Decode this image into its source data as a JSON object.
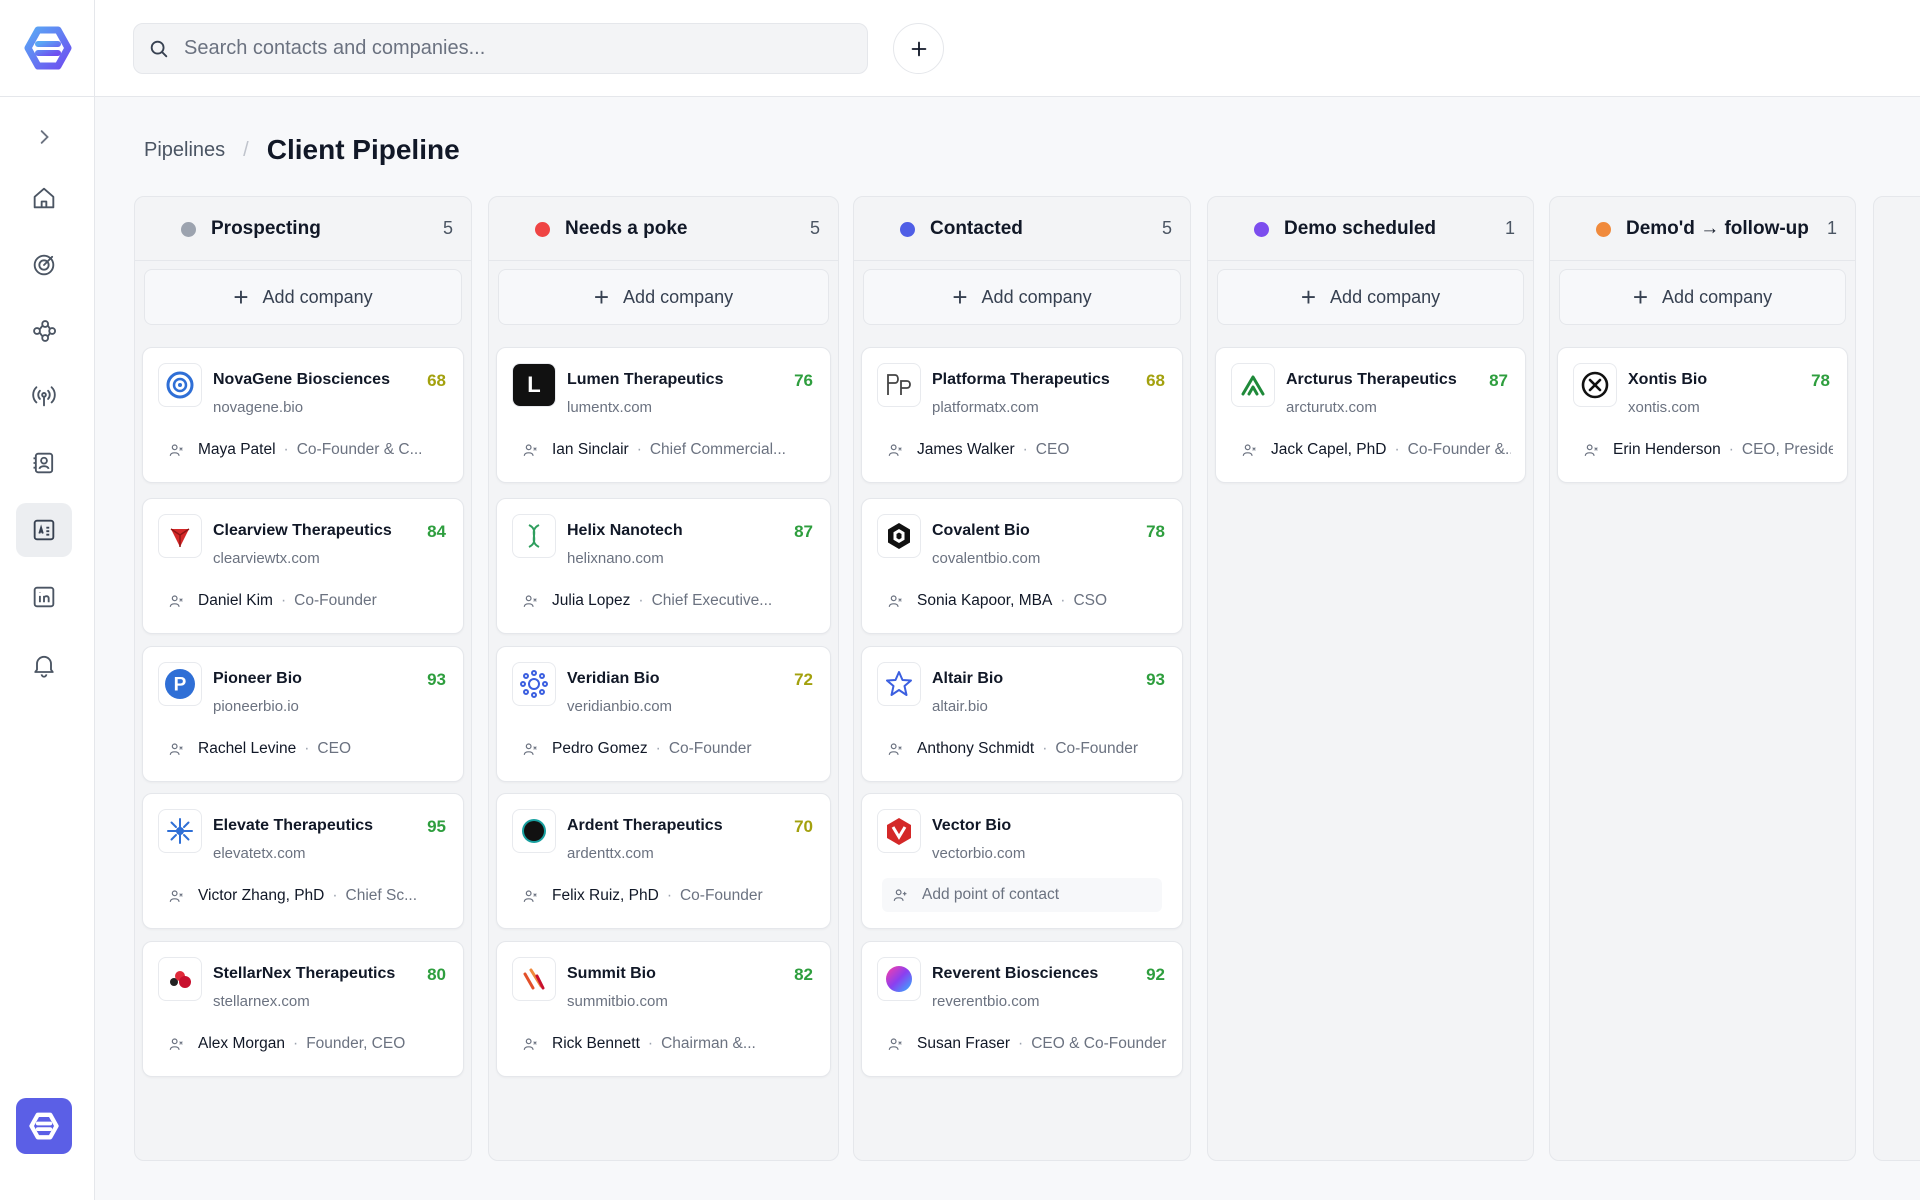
{
  "app": {
    "brand_color": "#5b5fe6"
  },
  "search": {
    "placeholder": "Search contacts and companies..."
  },
  "breadcrumb": {
    "parent": "Pipelines",
    "separator": "/",
    "current": "Client Pipeline"
  },
  "sidebar": {
    "items": [
      {
        "icon": "chevron-right-icon"
      },
      {
        "icon": "home-icon"
      },
      {
        "icon": "target-icon"
      },
      {
        "icon": "network-icon"
      },
      {
        "icon": "broadcast-icon"
      },
      {
        "icon": "contacts-icon"
      },
      {
        "icon": "companies-icon",
        "active": true
      },
      {
        "icon": "linkedin-icon"
      },
      {
        "icon": "bell-icon"
      }
    ]
  },
  "add_company_label": "Add company",
  "columns": [
    {
      "title": "Prospecting",
      "count": "5",
      "color": "#9ca3af",
      "cards": [
        {
          "name": "NovaGene Biosciences",
          "domain": "novagene.bio",
          "score": "68",
          "score_color": "#a3a10e",
          "contact": "Maya Patel",
          "role": "Co-Founder & C...",
          "logo": "novagene"
        },
        {
          "name": "Clearview Therapeutics",
          "domain": "clearviewtx.com",
          "score": "84",
          "score_color": "#2e9e3e",
          "contact": "Daniel Kim",
          "role": "Co-Founder",
          "logo": "clearview"
        },
        {
          "name": "Pioneer Bio",
          "domain": "pioneerbio.io",
          "score": "93",
          "score_color": "#2e9e3e",
          "contact": "Rachel Levine",
          "role": "CEO",
          "logo": "pioneer"
        },
        {
          "name": "Elevate Therapeutics",
          "domain": "elevatetx.com",
          "score": "95",
          "score_color": "#2e9e3e",
          "contact": "Victor Zhang, PhD",
          "role": "Chief Sc...",
          "logo": "elevate"
        },
        {
          "name": "StellarNex Therapeutics",
          "domain": "stellarnex.com",
          "score": "80",
          "score_color": "#2e9e3e",
          "contact": "Alex Morgan",
          "role": "Founder, CEO",
          "logo": "stellarnex"
        }
      ]
    },
    {
      "title": "Needs a poke",
      "count": "5",
      "color": "#ef4444",
      "cards": [
        {
          "name": "Lumen Therapeutics",
          "domain": "lumentx.com",
          "score": "76",
          "score_color": "#2e9e3e",
          "contact": "Ian Sinclair",
          "role": "Chief Commercial...",
          "logo": "lumen"
        },
        {
          "name": "Helix Nanotech",
          "domain": "helixnano.com",
          "score": "87",
          "score_color": "#2e9e3e",
          "contact": "Julia Lopez",
          "role": "Chief Executive...",
          "logo": "helix"
        },
        {
          "name": "Veridian Bio",
          "domain": "veridianbio.com",
          "score": "72",
          "score_color": "#a3a10e",
          "contact": "Pedro Gomez",
          "role": "Co-Founder",
          "logo": "veridian"
        },
        {
          "name": "Ardent Therapeutics",
          "domain": "ardenttx.com",
          "score": "70",
          "score_color": "#a3a10e",
          "contact": "Felix Ruiz, PhD",
          "role": "Co-Founder",
          "logo": "ardent"
        },
        {
          "name": "Summit Bio",
          "domain": "summitbio.com",
          "score": "82",
          "score_color": "#2e9e3e",
          "contact": "Rick Bennett",
          "role": "Chairman &...",
          "logo": "summit"
        }
      ]
    },
    {
      "title": "Contacted",
      "count": "5",
      "color": "#4f5ee6",
      "cards": [
        {
          "name": "Platforma Therapeutics",
          "domain": "platformatx.com",
          "score": "68",
          "score_color": "#a3a10e",
          "contact": "James Walker",
          "role": "CEO",
          "logo": "platforma"
        },
        {
          "name": "Covalent Bio",
          "domain": "covalentbio.com",
          "score": "78",
          "score_color": "#2e9e3e",
          "contact": "Sonia Kapoor, MBA",
          "role": "CSO",
          "logo": "covalent"
        },
        {
          "name": "Altair Bio",
          "domain": "altair.bio",
          "score": "93",
          "score_color": "#2e9e3e",
          "contact": "Anthony Schmidt",
          "role": "Co-Founder",
          "logo": "altair"
        },
        {
          "name": "Vector Bio",
          "domain": "vectorbio.com",
          "score": "",
          "score_color": "#2e9e3e",
          "contact": "",
          "role": "",
          "empty_contact": "Add point of contact",
          "logo": "vector"
        },
        {
          "name": "Reverent Biosciences",
          "domain": "reverentbio.com",
          "score": "92",
          "score_color": "#2e9e3e",
          "contact": "Susan Fraser",
          "role": "CEO & Co-Founder",
          "logo": "reverent"
        }
      ]
    },
    {
      "title": "Demo scheduled",
      "count": "1",
      "color": "#7c4dee",
      "cards": [
        {
          "name": "Arcturus Therapeutics",
          "domain": "arcturutx.com",
          "score": "87",
          "score_color": "#2e9e3e",
          "contact": "Jack Capel, PhD",
          "role": "Co-Founder &...",
          "logo": "arcturus"
        }
      ]
    },
    {
      "title": "Demo'd → follow-up",
      "count": "1",
      "color": "#f08a3c",
      "cards": [
        {
          "name": "Xontis Bio",
          "domain": "xontis.com",
          "score": "78",
          "score_color": "#2e9e3e",
          "contact": "Erin Henderson",
          "role": "CEO, President",
          "logo": "xontis"
        }
      ]
    }
  ]
}
